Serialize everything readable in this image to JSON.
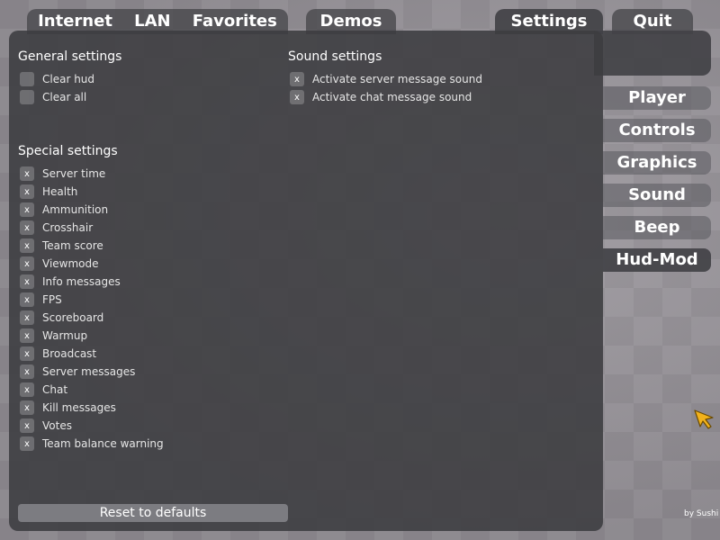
{
  "top_tabs": {
    "internet": "Internet",
    "lan": "LAN",
    "favorites": "Favorites",
    "demos": "Demos",
    "settings": "Settings",
    "quit": "Quit"
  },
  "general_settings": {
    "title": "General settings",
    "items": [
      {
        "label": "Clear hud",
        "checked": false,
        "mark": ""
      },
      {
        "label": "Clear all",
        "checked": false,
        "mark": ""
      }
    ]
  },
  "sound_settings": {
    "title": "Sound settings",
    "items": [
      {
        "label": "Activate server message sound",
        "checked": true,
        "mark": "x"
      },
      {
        "label": "Activate chat message sound",
        "checked": true,
        "mark": "x"
      }
    ]
  },
  "special_settings": {
    "title": "Special settings",
    "items": [
      {
        "label": "Server time",
        "checked": true,
        "mark": "x"
      },
      {
        "label": "Health",
        "checked": true,
        "mark": "x"
      },
      {
        "label": "Ammunition",
        "checked": true,
        "mark": "x"
      },
      {
        "label": "Crosshair",
        "checked": true,
        "mark": "x"
      },
      {
        "label": "Team score",
        "checked": true,
        "mark": "x"
      },
      {
        "label": "Viewmode",
        "checked": true,
        "mark": "x"
      },
      {
        "label": "Info messages",
        "checked": true,
        "mark": "x"
      },
      {
        "label": "FPS",
        "checked": true,
        "mark": "x"
      },
      {
        "label": "Scoreboard",
        "checked": true,
        "mark": "x"
      },
      {
        "label": "Warmup",
        "checked": true,
        "mark": "x"
      },
      {
        "label": "Broadcast",
        "checked": true,
        "mark": "x"
      },
      {
        "label": "Server messages",
        "checked": true,
        "mark": "x"
      },
      {
        "label": "Chat",
        "checked": true,
        "mark": "x"
      },
      {
        "label": "Kill messages",
        "checked": true,
        "mark": "x"
      },
      {
        "label": "Votes",
        "checked": true,
        "mark": "x"
      },
      {
        "label": "Team balance warning",
        "checked": true,
        "mark": "x"
      }
    ]
  },
  "side_menu": {
    "items": [
      "Player",
      "Controls",
      "Graphics",
      "Sound",
      "Beep",
      "Hud-Mod"
    ],
    "active": "Hud-Mod"
  },
  "reset_button": "Reset to defaults",
  "credit": "by Sushi",
  "colors": {
    "cursor": "#f2b21b",
    "panel": "#3c3c40"
  },
  "icons": {
    "cursor": "arrow-cursor-icon"
  }
}
